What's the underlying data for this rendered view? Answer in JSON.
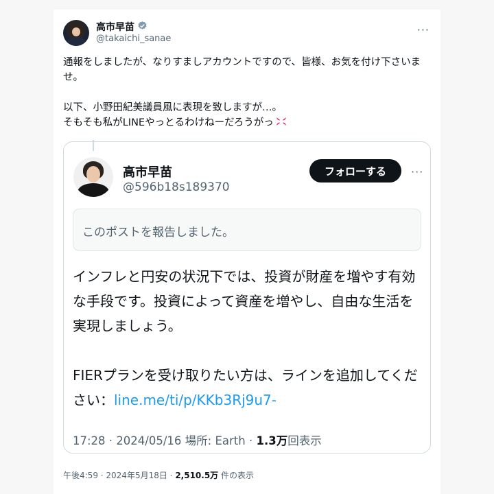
{
  "post": {
    "display_name": "高市早苗",
    "handle": "@takaichi_sanae",
    "more_label": "···",
    "body": "通報をしましたが、なりすましアカウントですので、皆様、お気を付け下さいませ。\n\n以下、小野田紀美議員風に表現を致しますが…。\nそもそも私がLINEやっとるわけねーだろうがっ",
    "time": "午後4:59",
    "date": "2024年5月18日",
    "views_count": "2,510.5万",
    "views_label": "件の表示"
  },
  "quote": {
    "display_name": "高市早苗",
    "handle": "@596b18s189370",
    "follow_label": "フォローする",
    "more_label": "···",
    "report_notice": "このポストを報告しました。",
    "text": "インフレと円安の状況下では、投資が財産を増やす有効な手段です。投資によって資産を増やし、自由な生活を実現しましょう。\n\nFIERプランを受け取りたい方は、ラインを追加してください：",
    "link": "line.me/ti/p/KKb3Rj9u7-",
    "time": "17:28",
    "date": "2024/05/16",
    "location": "場所: Earth",
    "views_count": "1.3万",
    "views_label": "回表示"
  },
  "icons": {
    "verified": "verified-badge-icon",
    "anger": "anger-symbol-icon",
    "more": "more-options-icon"
  },
  "colors": {
    "link": "#1d9bf0",
    "verified_badge": "#829aab",
    "anger_symbol": "#e0245e"
  }
}
